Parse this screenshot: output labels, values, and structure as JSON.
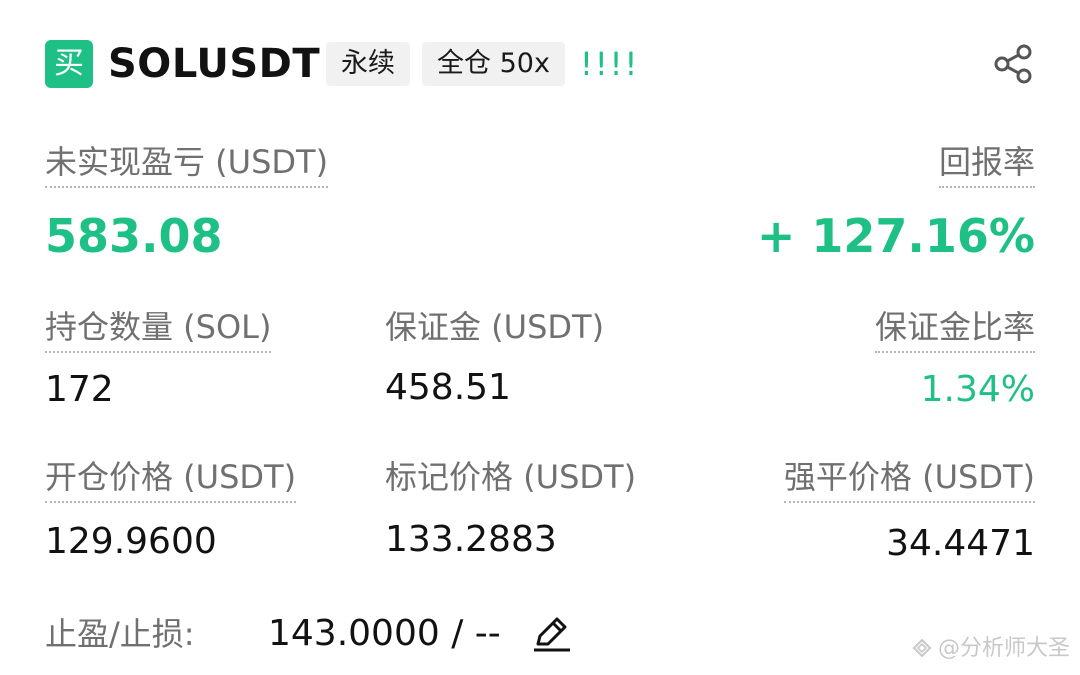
{
  "colors": {
    "green": "#1fc086",
    "gray": "#707070"
  },
  "header": {
    "side_badge": "买",
    "symbol": "SOLUSDT",
    "tag_perpetual": "永续",
    "tag_margin": "全仓 50x",
    "warning": "!!!!",
    "share_icon": "share-icon"
  },
  "pnl": {
    "label": "未实现盈亏 (USDT)",
    "value": "583.08",
    "roe_label": "回报率",
    "roe_value": "+ 127.16%"
  },
  "stats": {
    "size_label": "持仓数量 (SOL)",
    "size_value": "172",
    "margin_label": "保证金 (USDT)",
    "margin_value": "458.51",
    "margin_ratio_label": "保证金比率",
    "margin_ratio_value": "1.34%",
    "entry_label": "开仓价格 (USDT)",
    "entry_value": "129.9600",
    "mark_label": "标记价格 (USDT)",
    "mark_value": "133.2883",
    "liq_label": "强平价格 (USDT)",
    "liq_value": "34.4471"
  },
  "tpsl": {
    "label": "止盈/止损:",
    "value": "143.0000 / --",
    "edit_icon": "pencil-icon"
  },
  "watermark": {
    "text": "@分析师大圣"
  }
}
